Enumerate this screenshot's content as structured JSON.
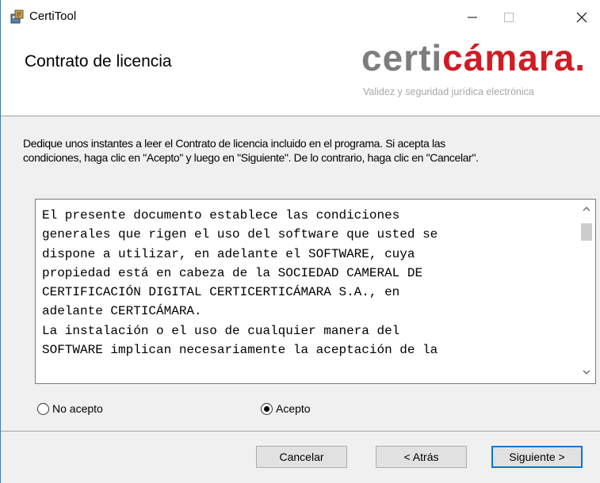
{
  "window": {
    "title": "CertiTool",
    "icon": "installer-icon"
  },
  "banner": {
    "title": "Contrato de licencia",
    "logo_part1": "certi",
    "logo_part2": "cámara.",
    "logo_tagline": "Validez y seguridad jurídica electrónica",
    "colors": {
      "logo_gray": "#7d7d7d",
      "logo_red": "#d01c24"
    }
  },
  "intro": {
    "line1": "Dedique unos instantes a leer el Contrato de licencia incluido en el programa. Si acepta las",
    "line2": "condiciones, haga clic en \"Acepto\" y luego en \"Siguiente\". De lo contrario, haga clic en \"Cancelar\"."
  },
  "license": {
    "lines": [
      "El presente documento establece las condiciones",
      "generales que rigen el uso del software que usted se",
      "dispone a utilizar, en adelante el SOFTWARE, cuya",
      "propiedad está en cabeza de la SOCIEDAD CAMERAL DE",
      "CERTIFICACIÓN DIGITAL CERTICERTICÁMARA S.A., en",
      "adelante CERTICÁMARA.",
      "",
      "La instalación o el uso de cualquier manera del",
      "SOFTWARE implican necesariamente la aceptación de la"
    ]
  },
  "options": {
    "reject_label": "No acepto",
    "accept_label": "Acepto",
    "selected": "Acepto"
  },
  "buttons": {
    "cancel_label": "Cancelar",
    "back_label": "< Atrás",
    "next_label": "Siguiente >"
  }
}
